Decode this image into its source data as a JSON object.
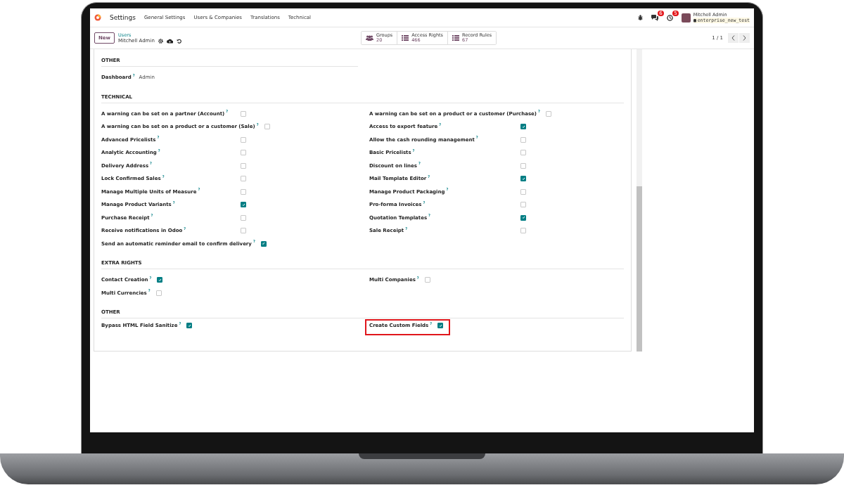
{
  "app": {
    "name": "Settings",
    "menu": [
      "General Settings",
      "Users & Companies",
      "Translations",
      "Technical"
    ]
  },
  "systray": {
    "chat_badge": "6",
    "activity_badge": "5",
    "user_name": "Mitchell Admin",
    "database": "enterprise_new_test"
  },
  "control_panel": {
    "new_button": "New",
    "breadcrumb_parent": "Users",
    "record_name": "Mitchell Admin",
    "pager": "1 / 1"
  },
  "smart_buttons": [
    {
      "kind": "groups",
      "label": "Groups",
      "count": "20"
    },
    {
      "kind": "list",
      "label": "Access Rights",
      "count": "466"
    },
    {
      "kind": "list",
      "label": "Record Rules",
      "count": "67"
    }
  ],
  "sections": [
    {
      "title": "OTHER",
      "kind": "select",
      "fields": [
        {
          "label": "Dashboard",
          "help": "?",
          "value": "Admin"
        }
      ]
    },
    {
      "title": "TECHNICAL",
      "kind": "aligned",
      "columns": [
        [
          {
            "label": "A warning can be set on a partner (Account)",
            "help": "?",
            "checked": false
          },
          {
            "label": "A warning can be set on a product or a customer (Sale)",
            "help": "?",
            "checked": false
          },
          {
            "label": "Advanced Pricelists",
            "help": "?",
            "checked": false
          },
          {
            "label": "Analytic Accounting",
            "help": "?",
            "checked": false
          },
          {
            "label": "Delivery Address",
            "help": "?",
            "checked": false
          },
          {
            "label": "Lock Confirmed Sales",
            "help": "?",
            "checked": false
          },
          {
            "label": "Manage Multiple Units of Measure",
            "help": "?",
            "checked": false
          },
          {
            "label": "Manage Product Variants",
            "help": "?",
            "checked": true
          },
          {
            "label": "Purchase Receipt",
            "help": "?",
            "checked": false
          },
          {
            "label": "Receive notifications in Odoo",
            "help": "?",
            "checked": false
          },
          {
            "label": "Send an automatic reminder email to confirm delivery",
            "help": "?",
            "checked": true
          }
        ],
        [
          {
            "label": "A warning can be set on a product or a customer (Purchase)",
            "help": "?",
            "checked": false
          },
          {
            "label": "Access to export feature",
            "help": "?",
            "checked": true
          },
          {
            "label": "Allow the cash rounding management",
            "help": "?",
            "checked": false
          },
          {
            "label": "Basic Pricelists",
            "help": "?",
            "checked": false
          },
          {
            "label": "Discount on lines",
            "help": "?",
            "checked": false
          },
          {
            "label": "Mail Template Editor",
            "help": "?",
            "checked": true
          },
          {
            "label": "Manage Product Packaging",
            "help": "?",
            "checked": false
          },
          {
            "label": "Pro-forma Invoices",
            "help": "?",
            "checked": false
          },
          {
            "label": "Quotation Templates",
            "help": "?",
            "checked": true
          },
          {
            "label": "Sale Receipt",
            "help": "?",
            "checked": false
          }
        ]
      ]
    },
    {
      "title": "EXTRA RIGHTS",
      "kind": "inline",
      "columns": [
        [
          {
            "label": "Contact Creation",
            "help": "?",
            "checked": true
          },
          {
            "label": "Multi Currencies",
            "help": "?",
            "checked": false
          }
        ],
        [
          {
            "label": "Multi Companies",
            "help": "?",
            "checked": false
          }
        ]
      ]
    },
    {
      "title": "OTHER",
      "kind": "inline",
      "columns": [
        [
          {
            "label": "Bypass HTML Field Sanitize",
            "help": "?",
            "checked": true,
            "highlighted": false
          }
        ],
        [
          {
            "label": "Create Custom Fields",
            "help": "?",
            "checked": true,
            "highlighted": true
          }
        ]
      ]
    }
  ]
}
